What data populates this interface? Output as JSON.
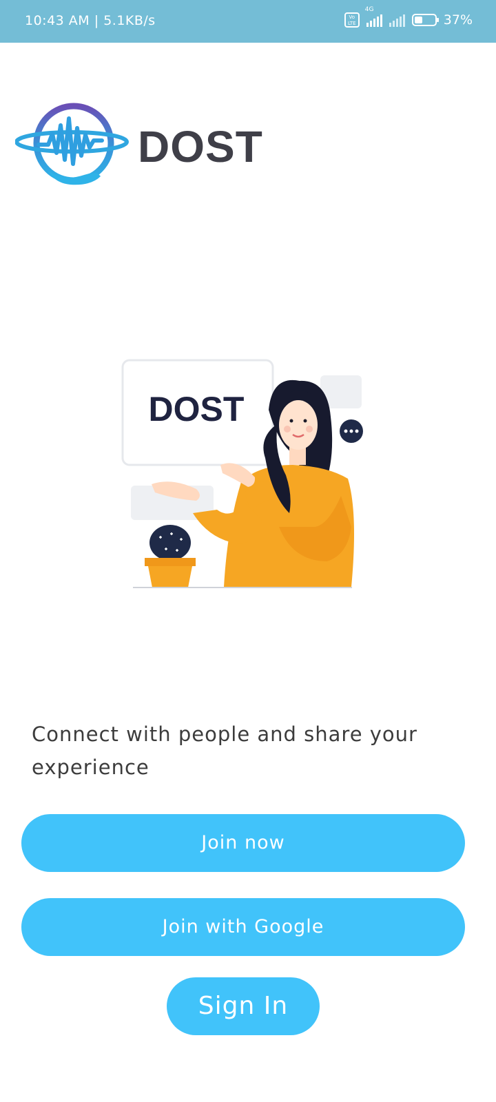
{
  "status_bar": {
    "time": "10:43 AM",
    "separator": "|",
    "net_speed": "5.1KB/s",
    "volte": "Vo LTE",
    "network": "4G",
    "battery": "37%",
    "battery_level": 0.37
  },
  "brand": {
    "name": "DOST",
    "logo_icon": "heartbeat-globe-hand-logo",
    "illustration_sign": "DOST"
  },
  "tagline": "Connect with people and share your experience",
  "actions": {
    "join_now": "Join now",
    "join_google": "Join with Google",
    "sign_in": "Sign In"
  },
  "colors": {
    "status_bar": "#74bdd6",
    "button": "#41c3fa",
    "brand_text": "#3f3f48",
    "sweater": "#f6a623"
  }
}
